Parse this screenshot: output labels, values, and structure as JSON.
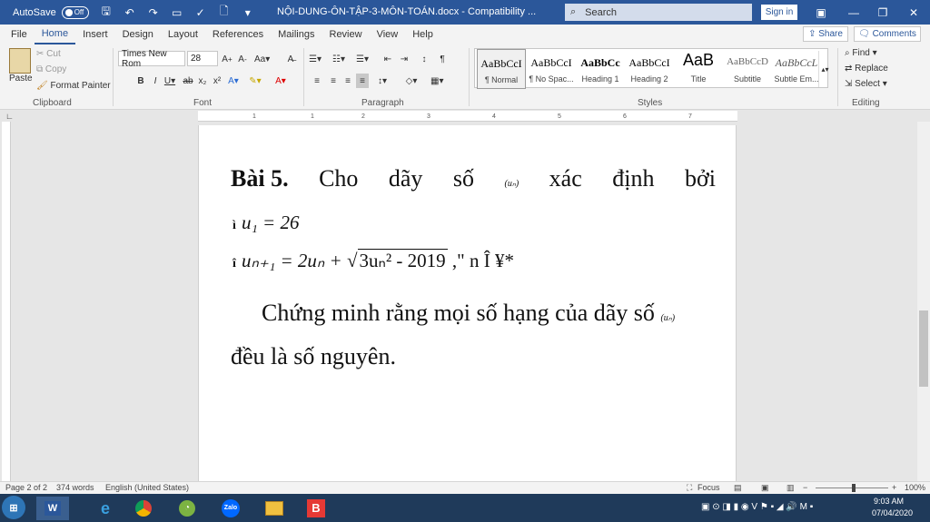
{
  "titlebar": {
    "autosave_label": "AutoSave",
    "autosave_state": "Off",
    "doc_title": "NỘI-DUNG-ÔN-TẬP-3-MÔN-TOÁN.docx  -  Compatibility ...",
    "search_placeholder": "Search",
    "signin_label": "Sign in"
  },
  "tabs": [
    "File",
    "Home",
    "Insert",
    "Design",
    "Layout",
    "References",
    "Mailings",
    "Review",
    "View",
    "Help"
  ],
  "active_tab": "Home",
  "share_label": "Share",
  "comments_label": "Comments",
  "clipboard": {
    "paste": "Paste",
    "cut": "Cut",
    "copy": "Copy",
    "format_painter": "Format Painter",
    "group": "Clipboard"
  },
  "font": {
    "name": "Times New Rom",
    "size": "28",
    "group": "Font"
  },
  "paragraph": {
    "group": "Paragraph"
  },
  "styles": {
    "group": "Styles",
    "items": [
      {
        "sample": "AaBbCcI",
        "name": "¶ Normal"
      },
      {
        "sample": "AaBbCcI",
        "name": "¶ No Spac..."
      },
      {
        "sample": "AaBbCc",
        "name": "Heading 1"
      },
      {
        "sample": "AaBbCcI",
        "name": "Heading 2"
      },
      {
        "sample": "AaB",
        "name": "Title"
      },
      {
        "sample": "AaBbCcD",
        "name": "Subtitle"
      },
      {
        "sample": "AaBbCcL",
        "name": "Subtle Em..."
      }
    ]
  },
  "editing": {
    "find": "Find",
    "replace": "Replace",
    "select": "Select",
    "group": "Editing"
  },
  "ruler_numbers": [
    "1",
    "1",
    "2",
    "3",
    "4",
    "5",
    "6",
    "7"
  ],
  "document": {
    "line1_bai": "Bài 5.",
    "line1_words": [
      "Cho",
      "dãy",
      "số",
      "(uₙ)",
      "xác",
      "định",
      "bởi"
    ],
    "eq1": "u₁ = 26",
    "eq2_left": "uₙ₊₁ = 2uₙ + ",
    "eq2_root": "3uₙ² -  2019",
    "eq2_right": " ,\" n Î  ¥*",
    "para2": "Chứng minh rằng mọi số hạng của dãy số",
    "para2_seq": "(uₙ)",
    "para3": "đều là số nguyên."
  },
  "status": {
    "page": "Page 2 of 2",
    "words": "374 words",
    "language": "English (United States)",
    "focus": "Focus",
    "zoom": "100%"
  },
  "taskbar": {
    "time": "9:03 AM",
    "date": "07/04/2020"
  }
}
